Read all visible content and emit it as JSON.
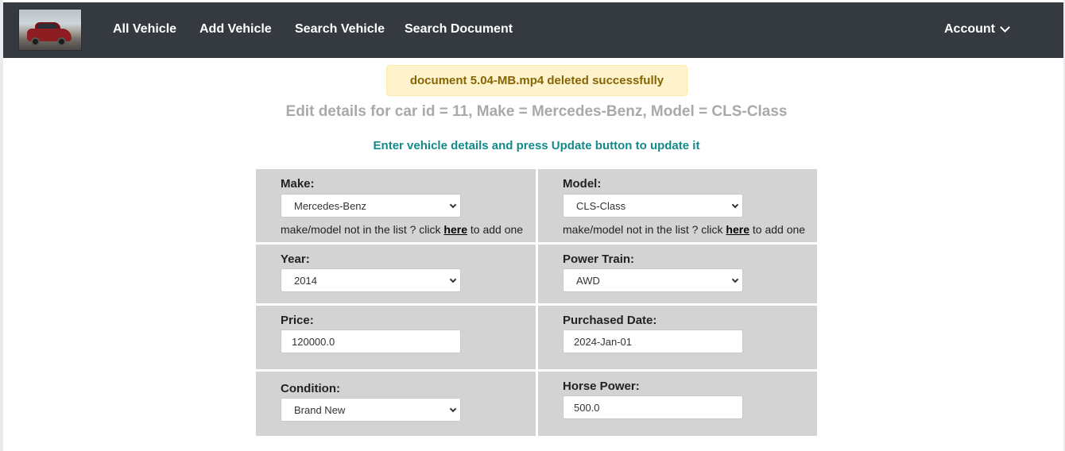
{
  "nav": {
    "links": [
      "All Vehicle",
      "Add Vehicle",
      "Search Vehicle",
      "Search Document"
    ],
    "account_label": "Account"
  },
  "alert": {
    "message": "document 5.04-MB.mp4 deleted successfully"
  },
  "page": {
    "title": "Edit details for car id = 11, Make = Mercedes-Benz, Model = CLS-Class",
    "instructions": "Enter vehicle details and press Update button to update it"
  },
  "form": {
    "make": {
      "label": "Make:",
      "value": "Mercedes-Benz"
    },
    "model": {
      "label": "Model:",
      "value": "CLS-Class"
    },
    "hint": {
      "prefix": "make/model not in the list ? click ",
      "link": "here",
      "suffix": " to add one"
    },
    "year": {
      "label": "Year:",
      "value": "2014"
    },
    "power_train": {
      "label": "Power Train:",
      "value": "AWD"
    },
    "price": {
      "label": "Price:",
      "value": "120000.0"
    },
    "purchased_date": {
      "label": "Purchased Date:",
      "value": "2024-Jan-01"
    },
    "condition": {
      "label": "Condition:",
      "value": "Brand New"
    },
    "horse_power": {
      "label": "Horse Power:",
      "value": "500.0"
    }
  },
  "colors": {
    "navbar": "#343a40",
    "alert_bg": "#fff3cd",
    "alert_text": "#856404",
    "title_text": "#a9a9a9",
    "instructions_text": "#138a8a",
    "form_cell": "#d3d3d3"
  }
}
